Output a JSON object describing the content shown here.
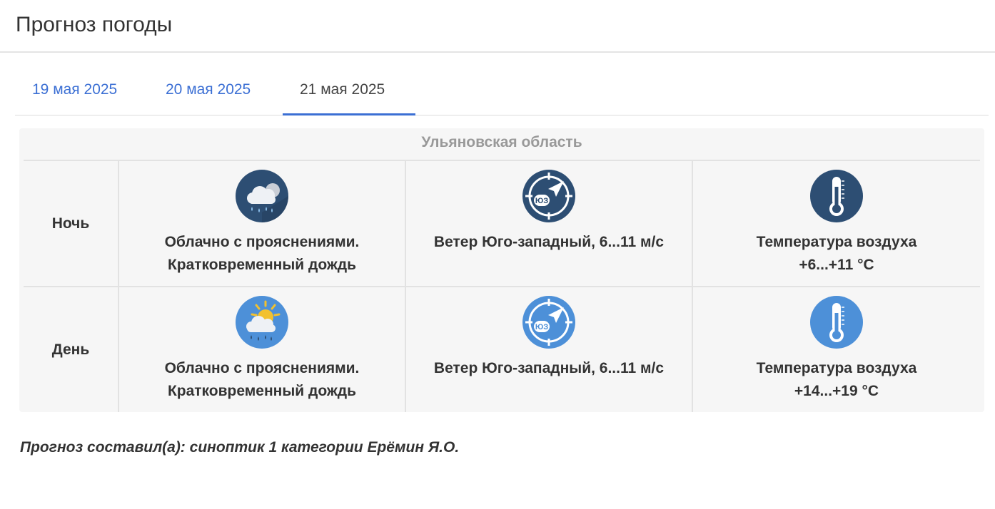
{
  "page": {
    "title": "Прогноз погоды"
  },
  "tabs": [
    {
      "label": "19 мая 2025",
      "active": false
    },
    {
      "label": "20 мая 2025",
      "active": false
    },
    {
      "label": "21 мая 2025",
      "active": true
    }
  ],
  "forecast": {
    "region": "Ульяновская область",
    "night": {
      "label": "Ночь",
      "weather_line1": "Облачно с прояснениями.",
      "weather_line2": "Кратковременный дождь",
      "weather_icon": "cloud-rain-night-icon",
      "wind": "Ветер Юго-западный, 6...11 м/с",
      "wind_badge": "ЮЗ",
      "wind_icon": "wind-compass-icon",
      "temp_line1": "Температура воздуха",
      "temp_line2": "+6...+11 °С",
      "temp_icon": "thermometer-icon",
      "icon_bg": "#2d4e73"
    },
    "day": {
      "label": "День",
      "weather_line1": "Облачно с прояснениями.",
      "weather_line2": "Кратковременный дождь",
      "weather_icon": "sun-cloud-rain-icon",
      "wind": "Ветер Юго-западный, 6...11 м/с",
      "wind_badge": "ЮЗ",
      "wind_icon": "wind-compass-icon",
      "temp_line1": "Температура воздуха",
      "temp_line2": "+14...+19 °С",
      "temp_icon": "thermometer-icon",
      "icon_bg": "#4d90d8"
    }
  },
  "footer": {
    "note": "Прогноз составил(а): синоптик 1 категории Ерёмин Я.О."
  },
  "colors": {
    "accent": "#3b6fd4",
    "night_icon": "#2d4e73",
    "day_icon": "#4d90d8",
    "sun": "#f2c12e"
  }
}
